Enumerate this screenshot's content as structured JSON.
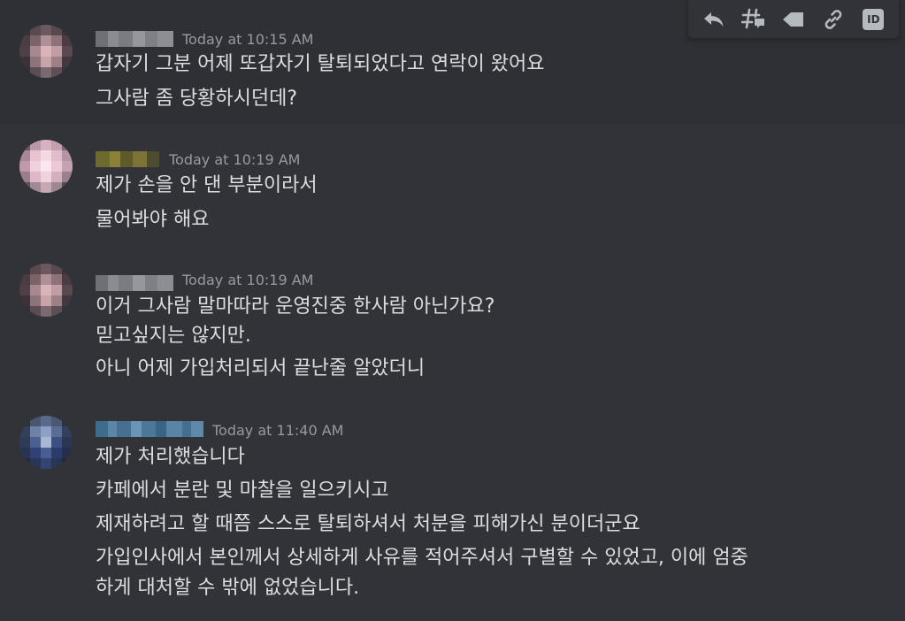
{
  "toolbar": {
    "icons": [
      "reply-icon",
      "create-thread-icon",
      "mark-unread-icon",
      "copy-link-icon",
      "copy-id-icon"
    ],
    "id_label": "ID"
  },
  "messages": [
    {
      "timestamp": "Today at 10:15 AM",
      "lines": [
        "갑자기 그분 어제 또갑자기 탈퇴되었다고 연락이 왔어요",
        "그사람 좀 당황하시던데?"
      ]
    },
    {
      "timestamp": "Today at 10:19 AM",
      "lines": [
        "제가 손을 안 댄 부분이라서",
        "물어봐야 해요"
      ]
    },
    {
      "timestamp": "Today at 10:19 AM",
      "lines": [
        "이거 그사람 말마따라 운영진중 한사람 아닌가요?",
        "믿고싶지는 않지만.",
        "아니 어제 가입처리되서 끝난줄 알았더니"
      ]
    },
    {
      "timestamp": "Today at 11:40 AM",
      "lines": [
        "제가 처리했습니다",
        "카페에서 분란 및 마찰을 일으키시고",
        "제재하려고 할 때쯤 스스로 탈퇴하셔서 처분을 피해가신 분이더군요",
        "가입인사에서 본인께서 상세하게 사유를 적어주셔서 구별할 수 있었고, 이에 엄중",
        "하게 대처할 수 밖에 없었습니다."
      ]
    }
  ],
  "colors": {
    "background": "#313338",
    "hover_background": "#2e3035",
    "text": "#dbdee1",
    "muted": "#949ba4",
    "toolbar_icon": "#b5bac1"
  }
}
